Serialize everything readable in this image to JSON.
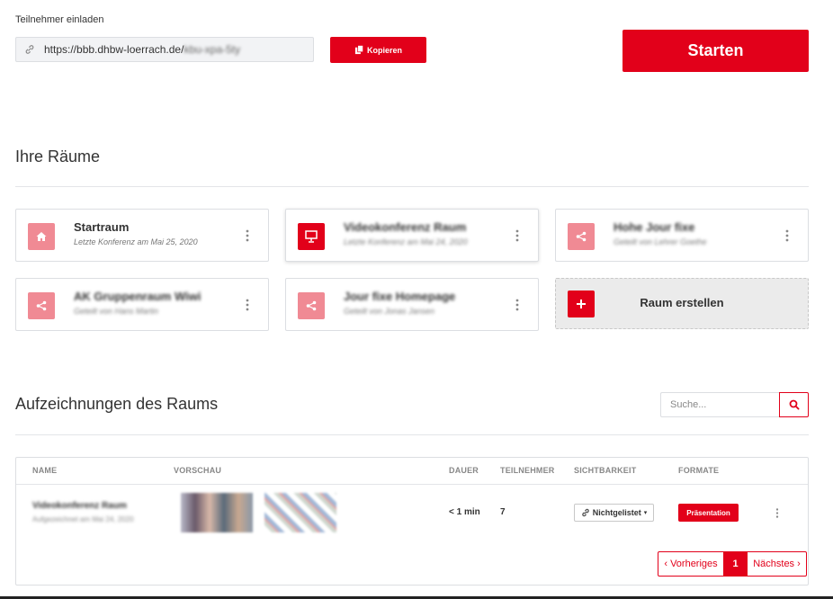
{
  "colors": {
    "accent": "#e2001a",
    "accent_light": "#f08a94"
  },
  "invite": {
    "label": "Teilnehmer einladen",
    "url_prefix": "https://bbb.dhbw-loerrach.de/",
    "url_suffix": "kbu-xpa-5ty",
    "copy_label": "Kopieren",
    "copy_icon": "copy-icon"
  },
  "start_label": "Starten",
  "rooms": {
    "heading": "Ihre Räume",
    "items": [
      {
        "title": "Startraum",
        "subtitle": "Letzte Konferenz am Mai 25, 2020",
        "icon": "home-icon"
      },
      {
        "title": "Videokonferenz Raum",
        "subtitle": "Letzte Konferenz am Mai 24, 2020",
        "icon": "presentation-icon"
      },
      {
        "title": "Hohe Jour fixe",
        "subtitle": "Geteilt von Lehrer Goethe",
        "icon": "share-icon"
      },
      {
        "title": "AK Gruppenraum Wiwi",
        "subtitle": "Geteilt von Hans Martin",
        "icon": "share-icon"
      },
      {
        "title": "Jour fixe Homepage",
        "subtitle": "Geteilt von Jonas Jansen",
        "icon": "share-icon"
      }
    ],
    "create_label": "Raum erstellen"
  },
  "recordings": {
    "heading": "Aufzeichnungen des Raums",
    "search_placeholder": "Suche...",
    "columns": [
      "NAME",
      "VORSCHAU",
      "DAUER",
      "TEILNEHMER",
      "SICHTBARKEIT",
      "FORMATE"
    ],
    "rows": [
      {
        "name": "Videokonferenz Raum",
        "date": "Aufgezeichnet am Mai 24, 2020",
        "duration": "< 1 min",
        "participants": "7",
        "visibility": "Nichtgelistet",
        "format": "Präsentation"
      }
    ],
    "pagination": {
      "prev": "‹ Vorheriges",
      "current": "1",
      "next": "Nächstes ›"
    }
  }
}
